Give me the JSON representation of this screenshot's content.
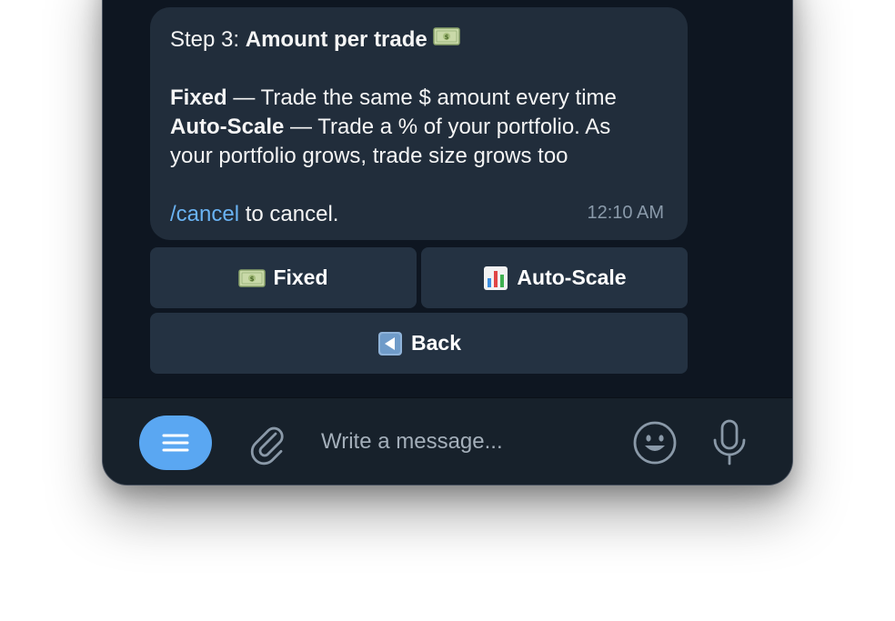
{
  "message": {
    "step_prefix": "Step 3: ",
    "step_title": "Amount per trade",
    "line1_bold": "Fixed",
    "line1_rest": " — Trade the same $ amount every time",
    "line2_bold": "Auto-Scale",
    "line2_rest": " — Trade a % of your portfolio. As",
    "line3": "your portfolio grows, trade size grows too",
    "cancel_command": "/cancel",
    "cancel_rest": " to cancel.",
    "time": "12:10 AM"
  },
  "keyboard": {
    "fixed_label": "Fixed",
    "autoscale_label": "Auto-Scale",
    "back_label": "Back"
  },
  "composer": {
    "placeholder": "Write a message..."
  },
  "icons": {
    "money": "money-banknote-icon",
    "chart": "bar-chart-icon",
    "back": "back-arrow-icon",
    "menu": "menu-icon",
    "attach": "paperclip-icon",
    "emoji": "smiley-icon",
    "mic": "microphone-icon"
  },
  "colors": {
    "accent": "#5aa7f2",
    "link": "#6ab3f3",
    "bubble": "#212d3b",
    "button": "#243242"
  }
}
